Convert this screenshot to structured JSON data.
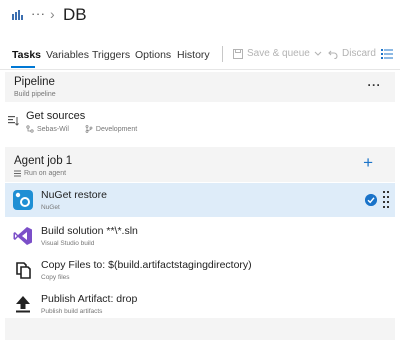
{
  "header": {
    "more_label": "···",
    "chevron": "›",
    "title": "DB"
  },
  "tabs": [
    {
      "label": "Tasks"
    },
    {
      "label": "Variables"
    },
    {
      "label": "Triggers"
    },
    {
      "label": "Options"
    },
    {
      "label": "History"
    }
  ],
  "toolbar": {
    "save_label": "Save & queue",
    "discard_label": "Discard"
  },
  "pipeline": {
    "title": "Pipeline",
    "subtitle": "Build pipeline",
    "more_label": "···"
  },
  "sources": {
    "title": "Get sources",
    "repo": "Sebas-Wil",
    "branch": "Development"
  },
  "agent_job": {
    "title": "Agent job 1",
    "subtitle": "Run on agent",
    "add_label": "+"
  },
  "tasks": [
    {
      "title": "NuGet restore",
      "subtitle": "NuGet",
      "icon": "nuget-icon",
      "selected": true
    },
    {
      "title": "Build solution **\\*.sln",
      "subtitle": "Visual Studio build",
      "icon": "visual-studio-icon"
    },
    {
      "title": "Copy Files to: $(build.artifactstagingdirectory)",
      "subtitle": "Copy files",
      "icon": "copy-files-icon"
    },
    {
      "title": "Publish Artifact: drop",
      "subtitle": "Publish build artifacts",
      "icon": "upload-icon"
    }
  ],
  "colors": {
    "accent": "#0078d4",
    "selected_row": "#deecf9",
    "section_bg": "#f4f4f4"
  }
}
